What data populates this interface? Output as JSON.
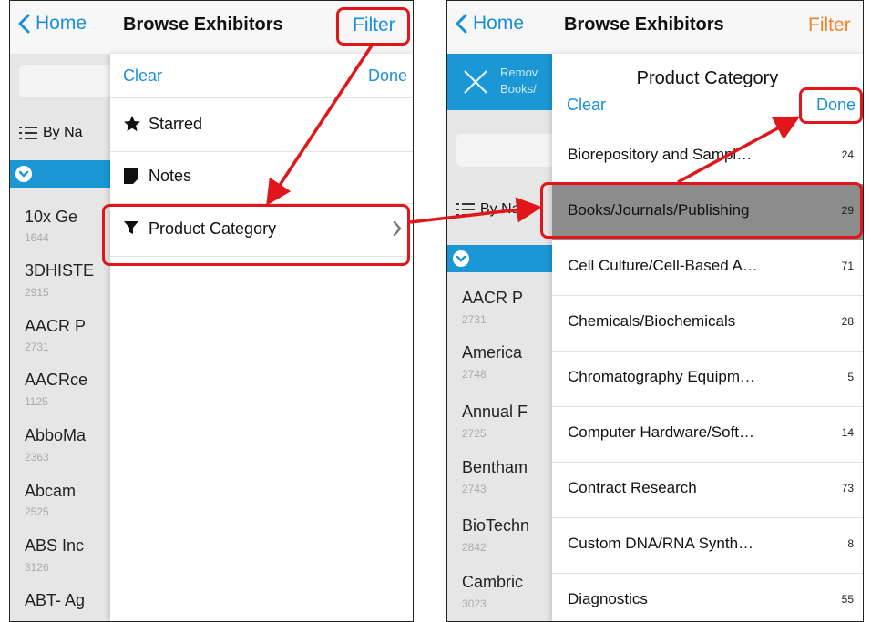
{
  "left_screen": {
    "nav": {
      "back_label": "Home",
      "title": "Browse Exhibitors",
      "filter_label": "Filter"
    },
    "by_name_label": "By Na",
    "exhibitors": [
      {
        "name": "10x Ge",
        "id": "1644"
      },
      {
        "name": "3DHISTE",
        "id": "2915"
      },
      {
        "name": "AACR P",
        "id": "2731"
      },
      {
        "name": "AACRce",
        "id": "1125"
      },
      {
        "name": "AbboMa",
        "id": "2363"
      },
      {
        "name": "Abcam",
        "id": "2525"
      },
      {
        "name": "ABS Inc",
        "id": "3126"
      },
      {
        "name": "ABT- Ag",
        "id": ""
      }
    ],
    "filter_panel": {
      "clear_label": "Clear",
      "done_label": "Done",
      "items": [
        {
          "label": "Starred",
          "icon": "star-icon"
        },
        {
          "label": "Notes",
          "icon": "note-icon"
        },
        {
          "label": "Product Category",
          "icon": "funnel-icon",
          "chevron": "chevron-right-icon"
        }
      ]
    }
  },
  "right_screen": {
    "nav": {
      "back_label": "Home",
      "title": "Browse Exhibitors",
      "filter_label": "Filter"
    },
    "remove_chip": {
      "line1": "Remov",
      "line2": "Books/",
      "icon": "close-icon"
    },
    "by_name_label": "By Na",
    "exhibitors": [
      {
        "name": "AACR P",
        "id": "2731"
      },
      {
        "name": "America",
        "id": "2748"
      },
      {
        "name": "Annual F",
        "id": "2725"
      },
      {
        "name": "Bentham",
        "id": "2743"
      },
      {
        "name": "BioTechn",
        "id": "2842"
      },
      {
        "name": "Cambric",
        "id": "3023"
      }
    ],
    "category_panel": {
      "title": "Product Category",
      "clear_label": "Clear",
      "done_label": "Done",
      "categories": [
        {
          "name": "Biorepository and Sampl…",
          "count": "24",
          "selected": false
        },
        {
          "name": "Books/Journals/Publishing",
          "count": "29",
          "selected": true
        },
        {
          "name": "Cell Culture/Cell-Based A…",
          "count": "71",
          "selected": false
        },
        {
          "name": "Chemicals/Biochemicals",
          "count": "28",
          "selected": false
        },
        {
          "name": "Chromatography Equipm…",
          "count": "5",
          "selected": false
        },
        {
          "name": "Computer Hardware/Soft…",
          "count": "14",
          "selected": false
        },
        {
          "name": "Contract Research",
          "count": "73",
          "selected": false
        },
        {
          "name": "Custom DNA/RNA Synth…",
          "count": "8",
          "selected": false
        },
        {
          "name": "Diagnostics",
          "count": "55",
          "selected": false
        }
      ]
    }
  },
  "colors": {
    "accent_blue": "#1a8fd8",
    "filter_orange": "#f0842c",
    "highlight_red": "#e0161b",
    "selected_row_gray": "#8c8c8c"
  }
}
